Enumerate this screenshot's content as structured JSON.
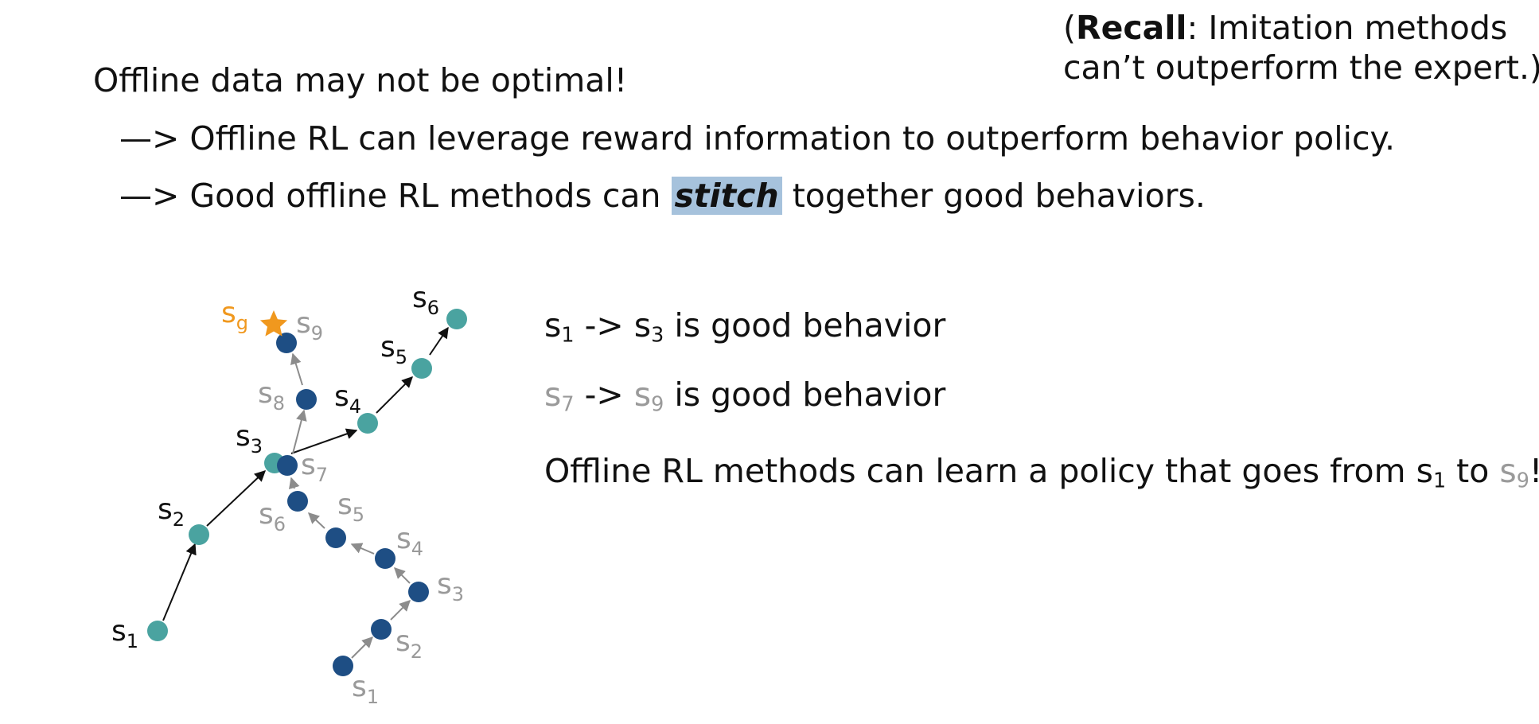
{
  "note": {
    "paren_open": "(",
    "bold": "Recall",
    "rest_line1": ": Imitation methods",
    "line2": "can’t outperform the expert.)"
  },
  "headline": "Offline data may not be optimal!",
  "bullets": {
    "b1": "—> Offline RL can leverage reward information to outperform behavior policy.",
    "b2_before": "—> Good offline RL methods can ",
    "b2_highlight": "stitch",
    "b2_after": " together good behaviors."
  },
  "statements": {
    "s1_a": "s",
    "s1_a_sub": "1",
    "s1_mid": " -> s",
    "s1_b_sub": "3",
    "s1_end": " is good behavior",
    "s2_a": "s",
    "s2_a_sub": "7",
    "s2_mid": " -> ",
    "s2_b": "s",
    "s2_b_sub": "9",
    "s2_end": " is good behavior",
    "s3_start": "Offline RL methods can learn a policy that goes from s",
    "s3_sub1": "1",
    "s3_mid": " to ",
    "s3_s": "s",
    "s3_sub2": "9",
    "s3_end": "!"
  },
  "diagram": {
    "goal_label": "s",
    "goal_sub": "g",
    "teal_labels": [
      {
        "s": "s",
        "sub": "1"
      },
      {
        "s": "s",
        "sub": "2"
      },
      {
        "s": "s",
        "sub": "3"
      },
      {
        "s": "s",
        "sub": "4"
      },
      {
        "s": "s",
        "sub": "5"
      },
      {
        "s": "s",
        "sub": "6"
      }
    ],
    "navy_labels": [
      {
        "s": "s",
        "sub": "1"
      },
      {
        "s": "s",
        "sub": "2"
      },
      {
        "s": "s",
        "sub": "3"
      },
      {
        "s": "s",
        "sub": "4"
      },
      {
        "s": "s",
        "sub": "5"
      },
      {
        "s": "s",
        "sub": "6"
      },
      {
        "s": "s",
        "sub": "7"
      },
      {
        "s": "s",
        "sub": "8"
      },
      {
        "s": "s",
        "sub": "9"
      }
    ],
    "colors": {
      "teal": "#4aa3a0",
      "navy": "#1e4e84",
      "goal": "#f0981e",
      "grey_text": "#9a9a9a",
      "black": "#111111",
      "grey_arrow": "#8c8c8c",
      "highlight": "#a6c2dc"
    }
  }
}
